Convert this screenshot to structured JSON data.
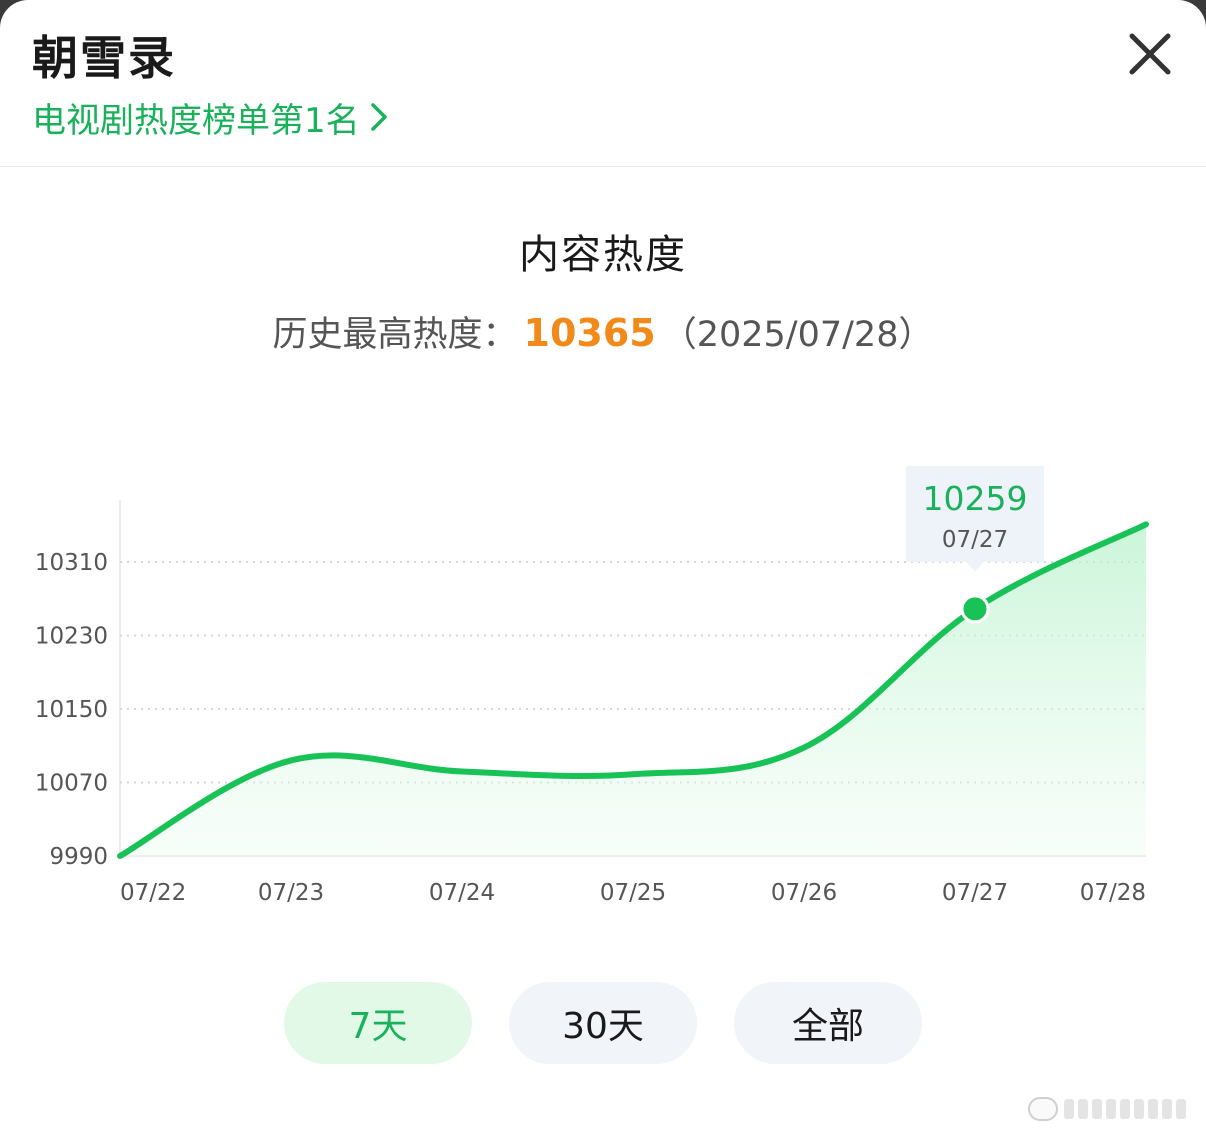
{
  "header": {
    "title": "朝雪录",
    "rank_link": "电视剧热度榜单第1名",
    "close_icon": "close-icon",
    "chevron_icon": "chevron-right-icon"
  },
  "content": {
    "section_title": "内容热度",
    "record_label": "历史最高热度：",
    "record_value": "10365",
    "record_date": "（2025/07/28）"
  },
  "colors": {
    "accent_green": "#19b25a",
    "highlight_orange": "#f28a1a"
  },
  "chart_data": {
    "type": "area",
    "title": "",
    "x": [
      "07/22",
      "07/23",
      "07/24",
      "07/25",
      "07/26",
      "07/27",
      "07/28"
    ],
    "values": [
      9990,
      10094,
      10082,
      10079,
      10108,
      10259,
      10351
    ],
    "y_ticks": [
      "9990",
      "10070",
      "10150",
      "10230",
      "10310"
    ],
    "ylim": [
      9990,
      10310
    ],
    "grid": true,
    "tooltip": {
      "value": "10259",
      "date": "07/27",
      "index": 5
    }
  },
  "range_buttons": [
    {
      "label": "7天",
      "active": true
    },
    {
      "label": "30天",
      "active": false
    },
    {
      "label": "全部",
      "active": false
    }
  ]
}
